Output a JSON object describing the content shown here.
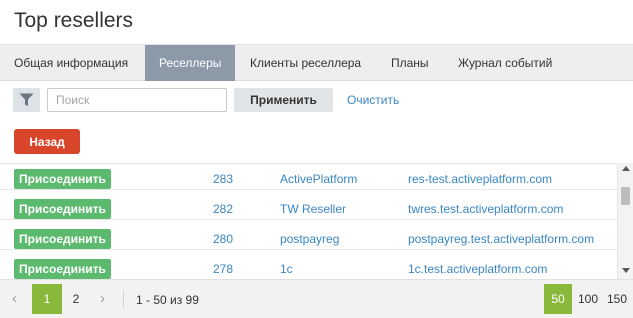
{
  "page": {
    "title": "Top resellers"
  },
  "tabs": [
    {
      "label": "Общая информация",
      "active": false
    },
    {
      "label": "Реселлеры",
      "active": true
    },
    {
      "label": "Клиенты реселлера",
      "active": false
    },
    {
      "label": "Планы",
      "active": false
    },
    {
      "label": "Журнал событий",
      "active": false
    }
  ],
  "filter": {
    "icon": "funnel-icon",
    "search_placeholder": "Поиск",
    "search_value": "",
    "apply_label": "Применить",
    "clear_label": "Очистить"
  },
  "back_label": "Назад",
  "rows": [
    {
      "action": "Присоединить",
      "id": "283",
      "name": "ActivePlatform",
      "domain": "res-test.activeplatform.com"
    },
    {
      "action": "Присоединить",
      "id": "282",
      "name": "TW Reseller",
      "domain": "twres.test.activeplatform.com"
    },
    {
      "action": "Присоединить",
      "id": "280",
      "name": "postpayreg",
      "domain": "postpayreg.test.activeplatform.com"
    },
    {
      "action": "Присоединить",
      "id": "278",
      "name": "1c",
      "domain": "1c.test.activeplatform.com"
    }
  ],
  "pagination": {
    "prev_icon": "‹",
    "next_icon": "›",
    "pages": [
      "1",
      "2"
    ],
    "current_page": "1",
    "summary": "1 - 50 из 99",
    "per_page_options": [
      "50",
      "100",
      "150"
    ],
    "per_page_selected": "50"
  },
  "colors": {
    "active_tab": "#8c9aa8",
    "join_button": "#5cba6e",
    "back_button": "#d9452b",
    "link": "#3a86c4",
    "pager_active": "#8ab83a"
  }
}
